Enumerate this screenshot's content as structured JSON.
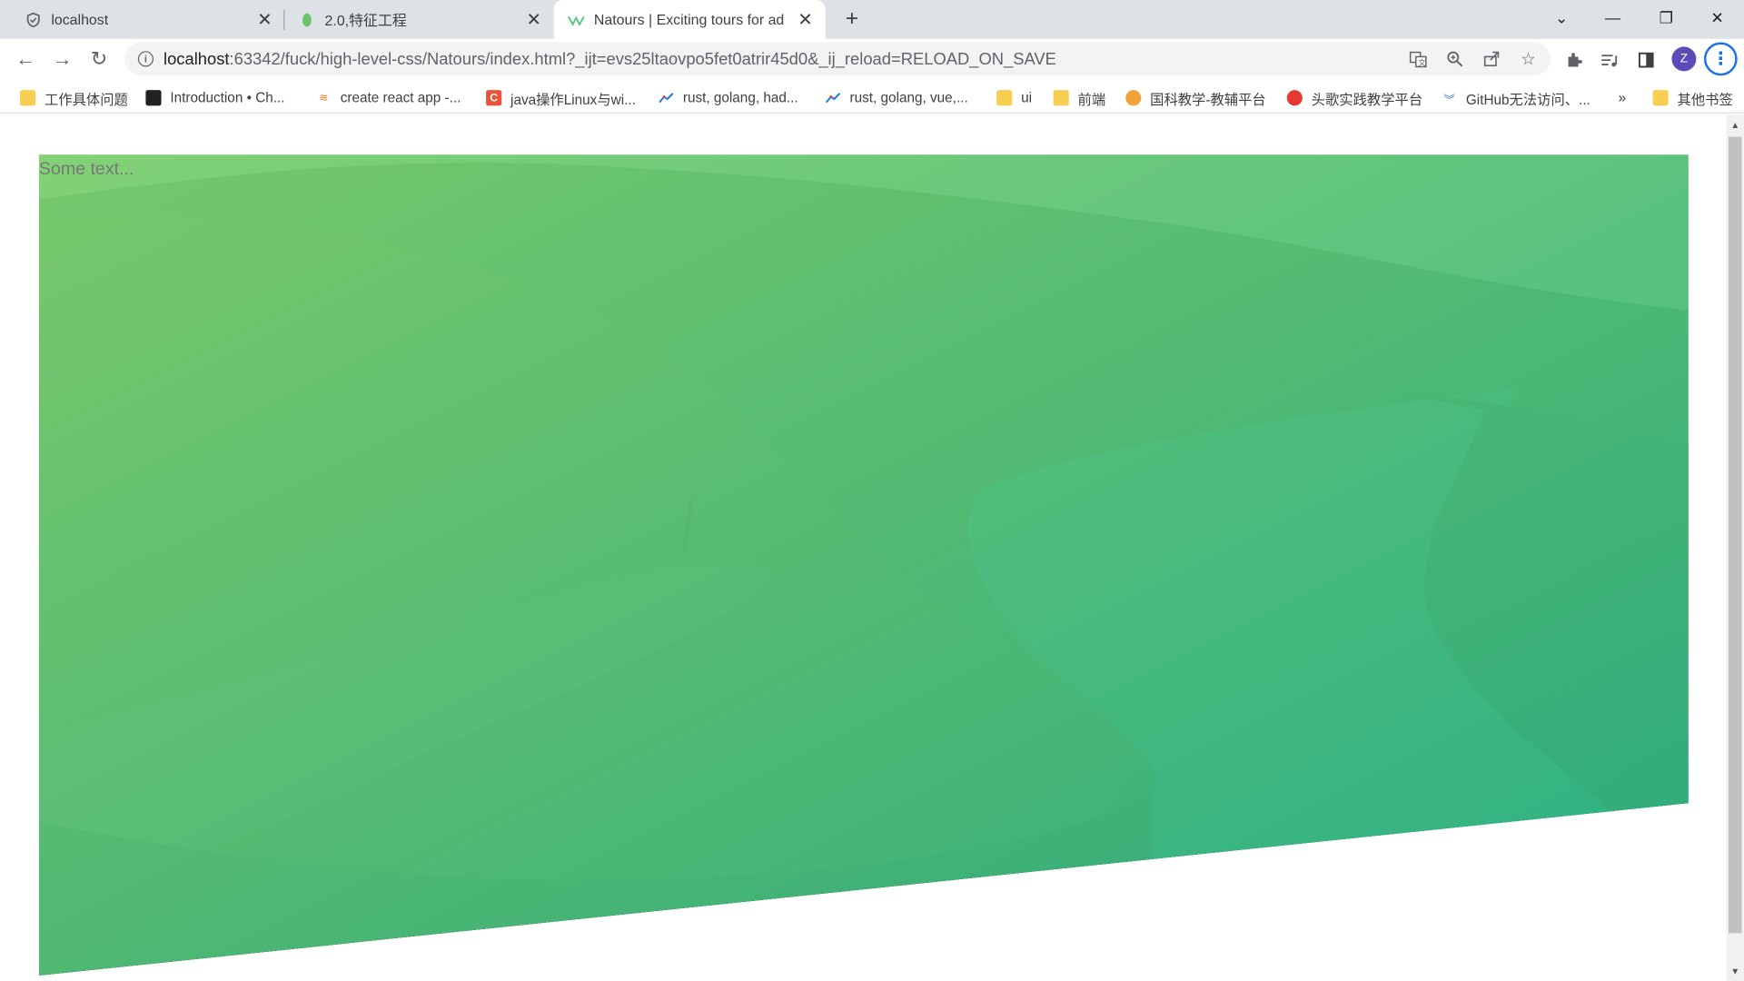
{
  "tabs": [
    {
      "title": "localhost",
      "icon": "shield-icon"
    },
    {
      "title": "2.0,特征工程",
      "icon": "leaf-icon"
    },
    {
      "title": "Natours | Exciting tours for ad",
      "icon": "natours-logo-icon"
    }
  ],
  "address_bar": {
    "url_host": "localhost",
    "url_rest": ":63342/fuck/high-level-css/Natours/index.html?_ijt=evs25ltaovpo5fet0atrir45d0&_ij_reload=RELOAD_ON_SAVE"
  },
  "profile": {
    "initial": "Z"
  },
  "bookmarks": [
    {
      "label": "工作具体问题",
      "icon": "folder-icon"
    },
    {
      "label": "Introduction • Ch...",
      "icon": "puzzle-icon"
    },
    {
      "label": "create react app -...",
      "icon": "stack-icon"
    },
    {
      "label": "java操作Linux与wi...",
      "icon": "c-logo-icon"
    },
    {
      "label": "rust, golang, had...",
      "icon": "trend-icon"
    },
    {
      "label": "rust, golang, vue,...",
      "icon": "trend-icon"
    },
    {
      "label": "ui",
      "icon": "folder-icon"
    },
    {
      "label": "前端",
      "icon": "folder-icon"
    },
    {
      "label": "国科教学-教辅平台",
      "icon": "tiger-icon"
    },
    {
      "label": "头歌实践教学平台",
      "icon": "toge-icon"
    },
    {
      "label": "GitHub无法访问、...",
      "icon": "chevrons-icon"
    }
  ],
  "bookmarks_more": "»",
  "other_bookmarks": "其他书签",
  "page": {
    "hero_text": "Some text...",
    "gradient_start": "#7ed56f",
    "gradient_end": "#28b485"
  }
}
